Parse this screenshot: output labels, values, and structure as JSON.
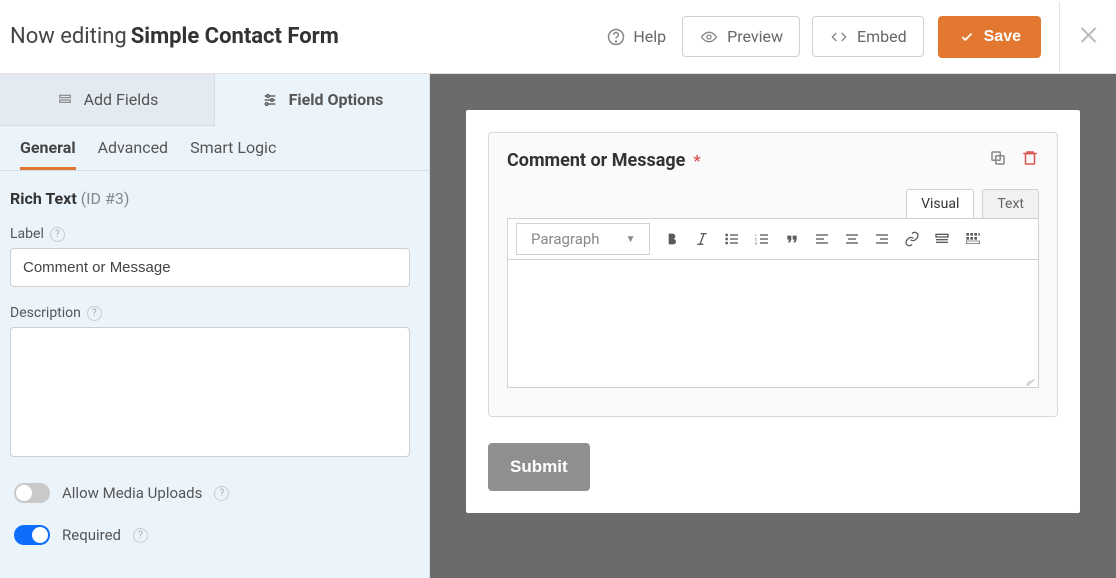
{
  "header": {
    "prefix": "Now editing",
    "form_name": "Simple Contact Form",
    "help": "Help",
    "preview": "Preview",
    "embed": "Embed",
    "save": "Save"
  },
  "sidebar": {
    "tabs": {
      "add_fields": "Add Fields",
      "field_options": "Field Options"
    },
    "subtabs": {
      "general": "General",
      "advanced": "Advanced",
      "smart_logic": "Smart Logic"
    },
    "field_type": "Rich Text",
    "field_id": "(ID #3)",
    "label_lbl": "Label",
    "label_val": "Comment or Message",
    "desc_lbl": "Description",
    "desc_val": "",
    "toggle_media": "Allow Media Uploads",
    "toggle_required": "Required"
  },
  "preview": {
    "field_label": "Comment or Message",
    "required_mark": "*",
    "rte_tabs": {
      "visual": "Visual",
      "text": "Text"
    },
    "format_selector": "Paragraph",
    "submit": "Submit"
  }
}
